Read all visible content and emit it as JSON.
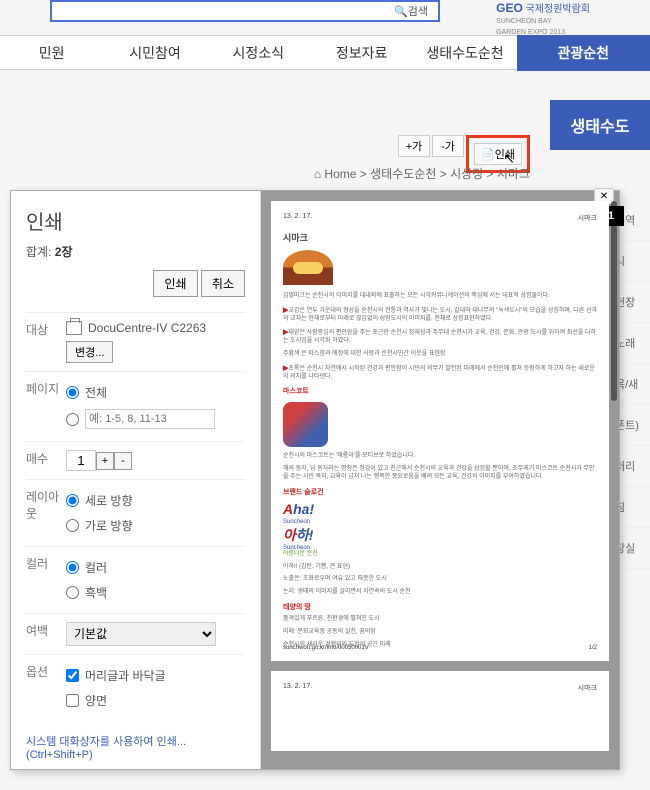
{
  "search": {
    "button": "검색"
  },
  "logo": {
    "geo": "GEO",
    "sub1": "SUNCHEON BAY",
    "sub2": "GARDEN EXPO 2013",
    "title": "국제정원박람회"
  },
  "nav": {
    "item1": "민원",
    "item2": "시민참여",
    "item3": "시정소식",
    "item4": "정보자료",
    "item5": "생태수도순천",
    "item6": "관광순천"
  },
  "subheader": "생태수도",
  "tools": {
    "plus": "+가",
    "minus": "-가",
    "print": "인쇄"
  },
  "breadcrumb": {
    "home": "Home",
    "p1": "생태수도순천",
    "p2": "시상징",
    "p3": "시마크",
    "sep": " > "
  },
  "sidebar": {
    "s1": "구역",
    "s2": "시",
    "s3": "헌장",
    "s4": "노래",
    "s5": "목/새",
    "s6": "폰트)",
    "s7": "러리",
    "s8": "침",
    "s9": "장실"
  },
  "dialog": {
    "title": "인쇄",
    "total_label": "합계:",
    "total_value": "2장",
    "btn_print": "인쇄",
    "btn_cancel": "취소",
    "target_label": "대상",
    "printer_name": "DocuCentre-IV C2263",
    "btn_change": "변경...",
    "page_label": "페이지",
    "page_all": "전체",
    "page_ph": "예: 1-5, 8, 11-13",
    "copies_label": "매수",
    "copies_val": "1",
    "layout_label": "레이아웃",
    "layout_v": "세로 방향",
    "layout_h": "가로 방향",
    "color_label": "컬러",
    "color_c": "컬러",
    "color_bw": "흑백",
    "margin_label": "여백",
    "margin_val": "기본값",
    "option_label": "옵션",
    "opt_hf": "머리글과 바닥글",
    "opt_duplex": "양면",
    "system_link": "시스템 대화상자를 사용하여 인쇄... (Ctrl+Shift+P)"
  },
  "preview": {
    "date": "13. 2. 17.",
    "pgtitle": "시마크",
    "section": "시마크",
    "t1": "심벌마크는 순천시의 이미지를 대내외에 표출하는 모든 시각커뮤니케이션의 핵심에 서는 대표적 상징물이다.",
    "t2": "교감은 연두 가운데의 형상을 순천시의 전통과 역사가 빛나는 도시, 갈대와 대나무의 \"녹색도시\"의 모습을 상징하며, 다른 선과의 교차는 현재로부터 미래로 끊임없이 성장도시의 이미지를, 전체로 상징표현하였다.",
    "t3": "태양은 사람중심의 편안함을 주는 포근한 순천시 정체성과 주무대 순천시가 교육, 건강, 문화, 관광 도시를 위하여 최선을 다하는 도시임을 시각화 하였다.",
    "t4": "주황색 은 따스함과 애정에 대한 사랑과 순천시민간 이웃을 표현함",
    "t5": "초록은 순천시 자연에서 시작된 건강과 편안함이 시민의 의무가 발전된 미래에서 순천인에 펼쳐 등장하게 하고자 하는 새로운의 의지를 나타낸다.",
    "mascot_title": "마스코트",
    "mt1": "순천시의 마스코트는 '해룡이'를 모티브로 하였습니다.",
    "mt2": "해의 동자, 남 동자라는 명칭은 정감이 있고 친근해서 순천시의 교육과 건강을 상징할 뿐이며, 조무래기 마스코트 순천시가 무안을 주는 시민 복지, 교육이 넘쳐 나는 행복한 풍요로움을 배려 모든 교육, 건강의 이미지를 부여하였습니다.",
    "brand_title": "브랜드 슬로건",
    "aha": "Aha!",
    "suncheon": "Suncheon",
    "aha_kr": "아하!",
    "sub": "아름다운 순천",
    "b1": "아하!! (감탄, 기쁨, 큰 표현)",
    "b2": "노출은: 조화로우며 여유 있고 따뜻한 도시",
    "b3": "논리: 생태의 이미지를 살리면서 자연속의 도시 순천",
    "tag_title": "태양의 땅",
    "tag1": "품격있게 푸르른, 친환경에 펼쳐진 도시",
    "tag2": "미래: 문화교육중 공동의 실천, 꿈의땅",
    "tag3": "순천시의 새라운 경쟁의의 도전의 공간 미래",
    "footer_url": "sunchwon.go.kr/info/00050001V",
    "page_num": "1/2",
    "badge": "1"
  }
}
